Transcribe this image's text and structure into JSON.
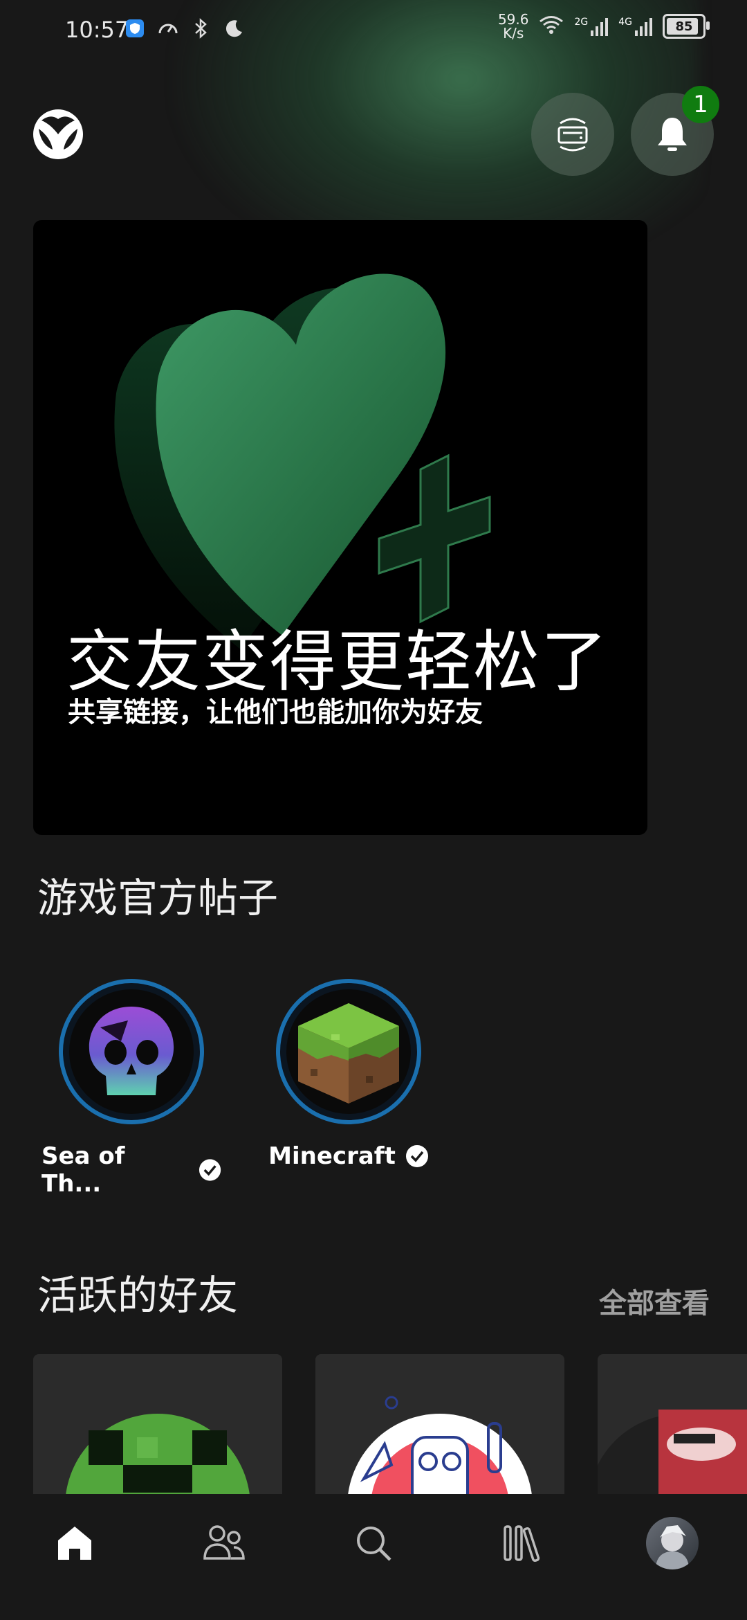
{
  "status_bar": {
    "time": "10:57",
    "net_speed_value": "59.6",
    "net_speed_unit": "K/s",
    "signal1_label": "2G",
    "signal2_label": "4G",
    "battery_level": "85"
  },
  "header": {
    "notification_count": "1"
  },
  "hero": {
    "title": "交友变得更轻松了",
    "subtitle": "共享链接，让他们也能加你为好友"
  },
  "official_posts": {
    "title": "游戏官方帖子",
    "items": [
      {
        "name": "Sea of Th..."
      },
      {
        "name": "Minecraft"
      }
    ]
  },
  "active_friends": {
    "title": "活跃的好友",
    "see_all": "全部查看"
  },
  "colors": {
    "accent": "#107c10",
    "ring": "#1a6fae",
    "background": "#181818"
  },
  "nav": [
    "home-icon",
    "people-icon",
    "search-icon",
    "library-icon",
    "profile-avatar"
  ]
}
